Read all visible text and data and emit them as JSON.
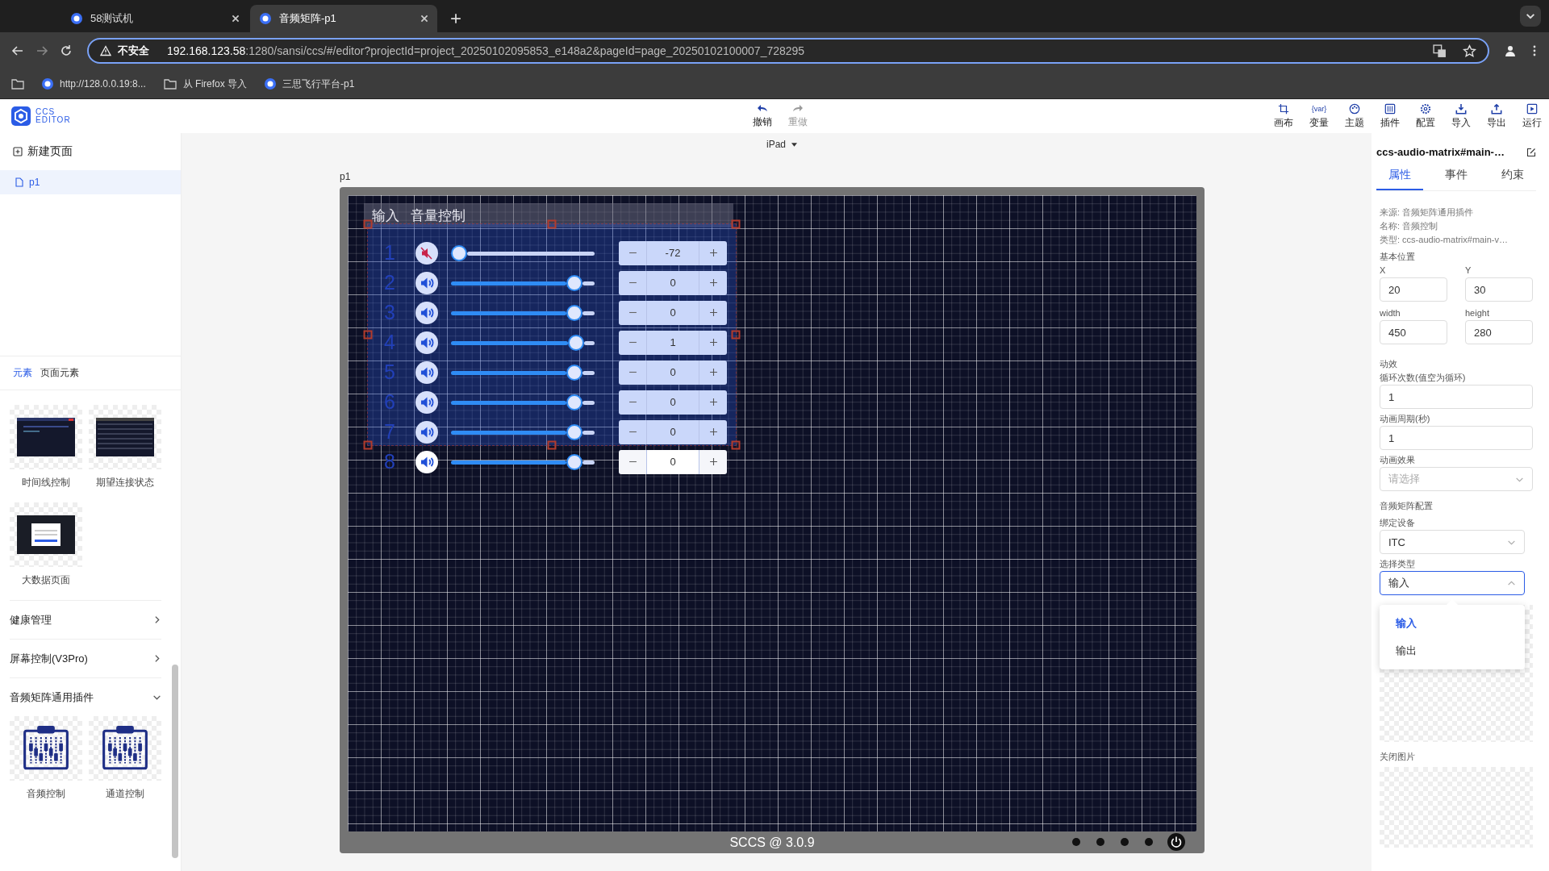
{
  "browser": {
    "tabs": [
      {
        "title": "58测试机",
        "selected": false
      },
      {
        "title": "音频矩阵-p1",
        "selected": true
      }
    ],
    "address": {
      "security": "不安全",
      "host": "192.168.123.58",
      "rest": ":1280/sansi/ccs/#/editor?projectId=project_20250102095853_e148a2&pageId=page_20250102100007_728295"
    },
    "bookmarks": [
      {
        "kind": "site",
        "label": "http://128.0.0.19:8..."
      },
      {
        "kind": "folder",
        "label": "从 Firefox 导入"
      },
      {
        "kind": "site",
        "label": "三思飞行平台-p1"
      }
    ]
  },
  "logo": {
    "line1": "CCS",
    "line2": "EDITOR"
  },
  "history": [
    {
      "label": "撤销",
      "disabled": false
    },
    {
      "label": "重做",
      "disabled": true
    }
  ],
  "tools": [
    {
      "label": "画布"
    },
    {
      "label": "变量",
      "badge": "{var}"
    },
    {
      "label": "主题"
    },
    {
      "label": "插件"
    },
    {
      "label": "配置"
    },
    {
      "label": "导入"
    },
    {
      "label": "导出"
    },
    {
      "label": "运行"
    }
  ],
  "device": "iPad",
  "pages": {
    "new_page": "新建页面",
    "items": [
      {
        "name": "p1",
        "selected": true
      }
    ]
  },
  "element_tabs": [
    {
      "label": "元素",
      "selected": true
    },
    {
      "label": "页面元素",
      "selected": false
    }
  ],
  "templates": [
    "时间线控制",
    "期望连接状态",
    "大数据页面"
  ],
  "categories": [
    {
      "name": "健康管理",
      "expanded": false
    },
    {
      "name": "屏幕控制(V3Pro)",
      "expanded": false
    },
    {
      "name": "音频矩阵通用插件",
      "expanded": true,
      "items": [
        "音频控制",
        "通道控制"
      ]
    }
  ],
  "canvas": {
    "page_label": "p1",
    "component": {
      "mode": "输入",
      "title": "音量控制",
      "channels": [
        {
          "number": "1",
          "muted": true,
          "level": 0,
          "value": "-72"
        },
        {
          "number": "2",
          "muted": false,
          "level": 0.86,
          "value": "0"
        },
        {
          "number": "3",
          "muted": false,
          "level": 0.86,
          "value": "0"
        },
        {
          "number": "4",
          "muted": false,
          "level": 0.87,
          "value": "1"
        },
        {
          "number": "5",
          "muted": false,
          "level": 0.86,
          "value": "0"
        },
        {
          "number": "6",
          "muted": false,
          "level": 0.86,
          "value": "0"
        },
        {
          "number": "7",
          "muted": false,
          "level": 0.86,
          "value": "0"
        },
        {
          "number": "8",
          "muted": false,
          "level": 0.86,
          "value": "0"
        }
      ]
    },
    "footer": "SCCS @ 3.0.9"
  },
  "properties": {
    "title": "ccs-audio-matrix#main-…",
    "tabs": [
      {
        "label": "属性",
        "selected": true
      },
      {
        "label": "事件",
        "selected": false
      },
      {
        "label": "约束",
        "selected": false
      }
    ],
    "info": [
      "来源: 音频矩阵通用插件",
      "名称: 音频控制",
      "类型: ccs-audio-matrix#main-v…"
    ],
    "position_heading": "基本位置",
    "pairs": [
      [
        {
          "label": "X",
          "value": "20"
        },
        {
          "label": "Y",
          "value": "30"
        }
      ],
      [
        {
          "label": "width",
          "value": "450"
        },
        {
          "label": "height",
          "value": "280"
        }
      ]
    ],
    "animation_heading": "动效",
    "loop": {
      "label": "循环次数(值空为循环)",
      "value": "1"
    },
    "period": {
      "label": "动画周期(秒)",
      "value": "1"
    },
    "effect": {
      "label": "动画效果",
      "placeholder": "请选择"
    },
    "matrix_heading": "音频矩阵配置",
    "device": {
      "label": "绑定设备",
      "value": "ITC"
    },
    "type": {
      "label": "选择类型",
      "value": "输入",
      "expanded": true,
      "options": [
        {
          "label": "输入",
          "selected": true
        },
        {
          "label": "输出",
          "selected": false
        }
      ]
    },
    "close_image": "关闭图片"
  }
}
